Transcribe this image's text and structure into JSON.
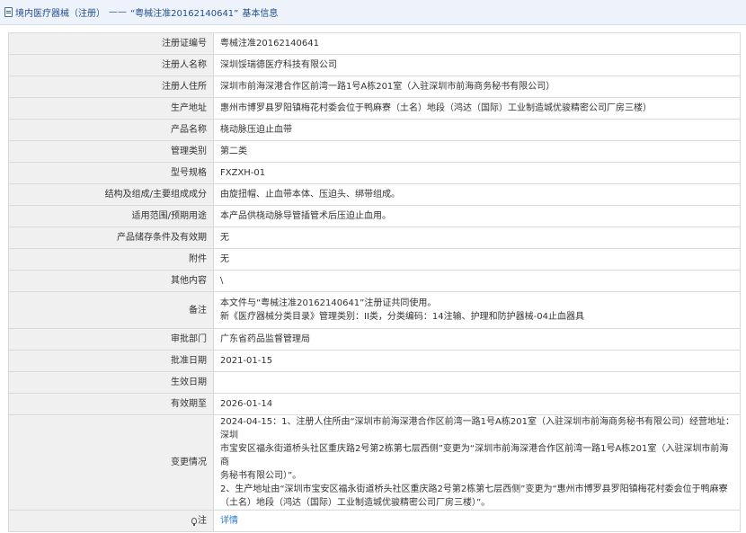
{
  "breadcrumb": {
    "home": "境内医疗器械（注册）",
    "separator": "——",
    "current": "“粤械注准20162140641”",
    "suffix": "基本信息"
  },
  "fields": {
    "reg_no": {
      "label": "注册证编号",
      "value": "粤械注准20162140641"
    },
    "registrant": {
      "label": "注册人名称",
      "value": "深圳馁瑞德医疗科技有限公司"
    },
    "registrant_address": {
      "label": "注册人住所",
      "value": "深圳市前海深港合作区前湾一路1号A栋201室（入驻深圳市前海商务秘书有限公司）"
    },
    "production_address": {
      "label": "生产地址",
      "value": "惠州市博罗县罗阳镇梅花村委会位于鸭麻寮（土名）地段（鸿达（国际）工业制造城优骏精密公司厂房三楼）"
    },
    "product_name": {
      "label": "产品名称",
      "value": "桡动脉压迫止血带"
    },
    "category": {
      "label": "管理类别",
      "value": "第二类"
    },
    "model": {
      "label": "型号规格",
      "value": "FXZXH-01"
    },
    "composition": {
      "label": "结构及组成/主要组成成分",
      "value": "由旋扭帽、止血带本体、压迫头、绑带组成。"
    },
    "scope": {
      "label": "适用范围/预期用途",
      "value": "本产品供桡动脉导管插管术后压迫止血用。"
    },
    "storage": {
      "label": "产品储存条件及有效期",
      "value": "无"
    },
    "attachment": {
      "label": "附件",
      "value": "无"
    },
    "other": {
      "label": "其他内容",
      "value": "\\"
    },
    "remarks": {
      "label": "备注",
      "line1": "本文件与“粤械注准20162140641”注册证共同使用。",
      "line2": "新《医疗器械分类目录》管理类别：II类，分类编码：14注输、护理和防护器械-04止血器具"
    },
    "approval_dept": {
      "label": "审批部门",
      "value": "广东省药品监督管理局"
    },
    "approval_date": {
      "label": "批准日期",
      "value": "2021-01-15"
    },
    "effective_date": {
      "label": "生效日期",
      "value": ""
    },
    "expiry_date": {
      "label": "有效期至",
      "value": "2026-01-14"
    },
    "changes": {
      "label": "变更情况",
      "lines": [
        "2024-04-15：1、注册人住所由“深圳市前海深港合作区前湾一路1号A栋201室（入驻深圳市前海商务秘书有限公司）经营地址：深圳",
        "市宝安区福永街道桥头社区重庆路2号第2栋第七层西侧”变更为“深圳市前海深港合作区前湾一路1号A栋201室（入驻深圳市前海商",
        "务秘书有限公司）”。",
        "2、生产地址由“深圳市宝安区福永街道桥头社区重庆路2号第2栋第七层西侧”变更为“惠州市博罗县罗阳镇梅花村委会位于鸭麻寮",
        "（土名）地段（鸿达（国际）工业制造城优骏精密公司厂房三楼）”。"
      ]
    },
    "note": {
      "label": "注",
      "link": "详情"
    }
  }
}
